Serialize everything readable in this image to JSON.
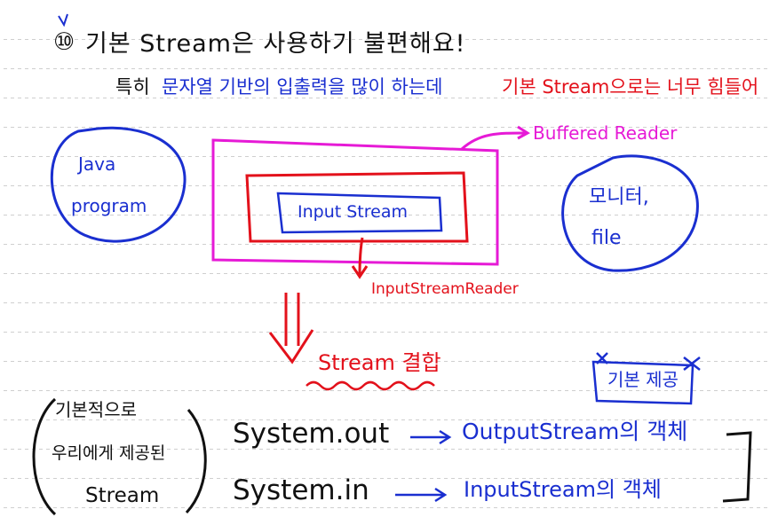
{
  "heading": {
    "marker": "⑩",
    "text": "기본 Stream은 사용하기 불편해요!"
  },
  "subheading": {
    "prefix": "특히",
    "blue_part": "문자열 기반의 입출력을 많이 하는데",
    "red_part": "기본 Stream으로는 너무 힘들어"
  },
  "left_circle": {
    "line1": "Java",
    "line2": "program"
  },
  "right_circle": {
    "line1": "모니터,",
    "line2": "file"
  },
  "labels": {
    "buffered_reader": "Buffered Reader",
    "input_stream": "Input Stream",
    "input_stream_reader": "InputStreamReader",
    "stream_chaining": "Stream 결합",
    "basic_provided": "기본 제공"
  },
  "bottom": {
    "paren_line1": "기본적으로",
    "paren_line2": "우리에게 제공된",
    "paren_line3": "Stream",
    "system_out": "System.out",
    "system_in": "System.in",
    "output_object": "OutputStream의 객체",
    "input_object": "InputStream의 객체"
  },
  "colors": {
    "black": "#111111",
    "blue": "#1a2fd0",
    "red": "#e3111b",
    "magenta": "#e61ad6"
  }
}
